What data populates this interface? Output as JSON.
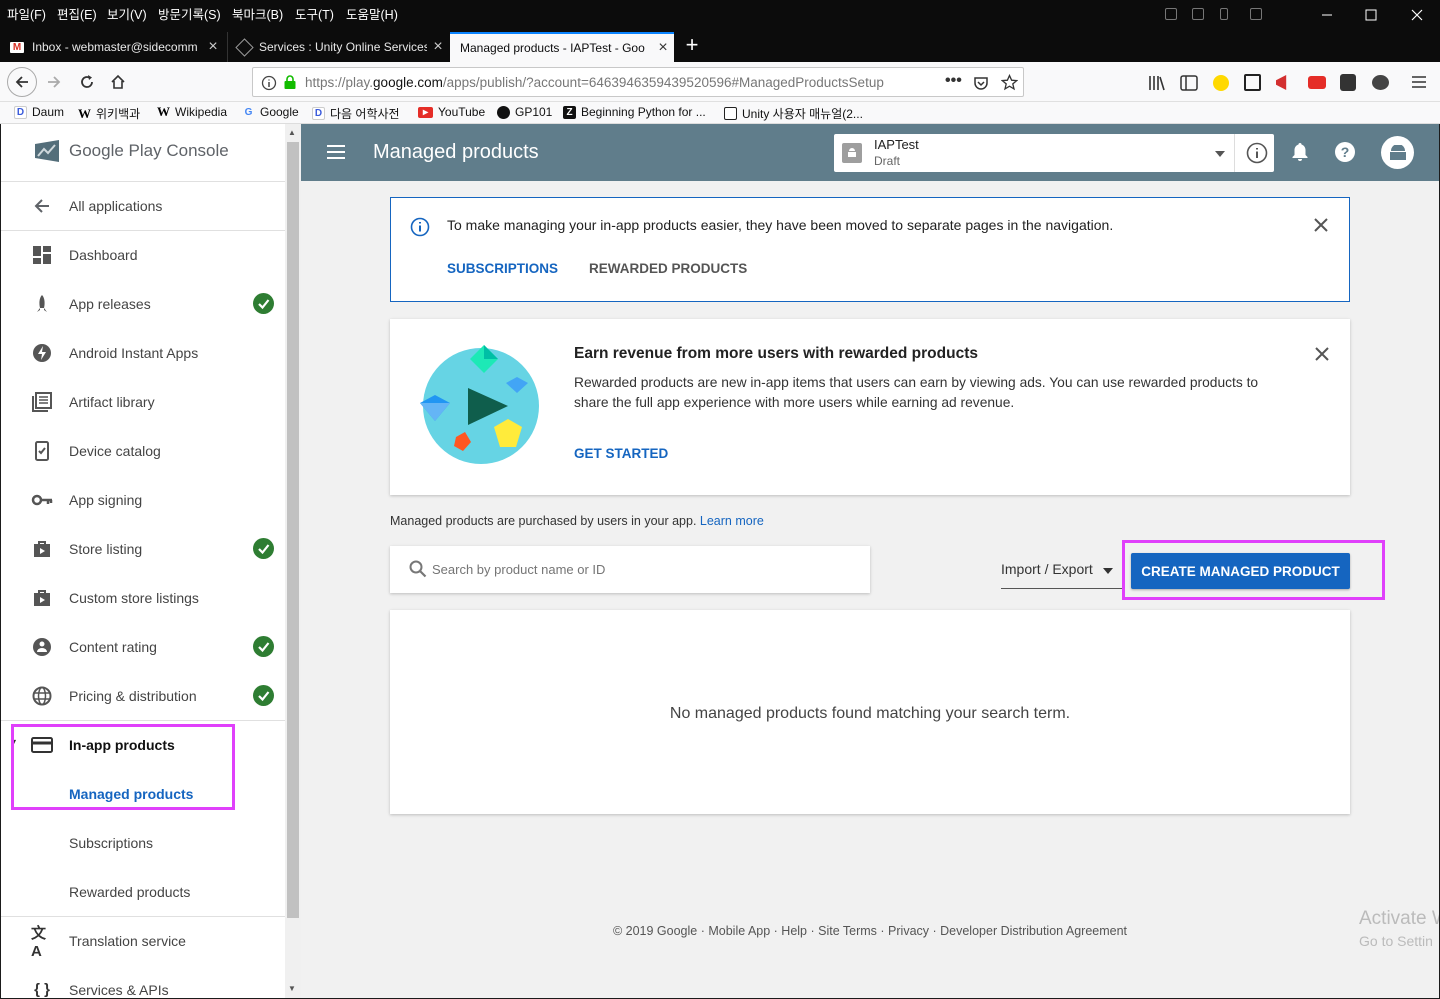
{
  "menubar": {
    "items": [
      "파일(F)",
      "편집(E)",
      "보기(V)",
      "방문기록(S)",
      "북마크(B)",
      "도구(T)",
      "도움말(H)"
    ]
  },
  "tabs": [
    {
      "title": "Inbox - webmaster@sidecomm",
      "icon": "gmail-icon"
    },
    {
      "title": "Services : Unity Online Services",
      "icon": "unity-icon"
    },
    {
      "title": "Managed products - IAPTest - Goo",
      "icon": "none"
    }
  ],
  "url": "https://play.google.com/apps/publish/?account=6463946359439520596#ManagedProductsSetup",
  "url_domain": "google.com",
  "bookmarks": [
    "Daum",
    "위키백과",
    "Wikipedia",
    "Google",
    "다음 어학사전",
    "YouTube",
    "GP101",
    "Beginning Python for ...",
    "Unity 사용자 매뉴얼(2..."
  ],
  "sidebar": {
    "logo": "Google Play Console",
    "back": "All applications",
    "items": [
      {
        "label": "Dashboard",
        "icon": "dashboard-icon",
        "check": false
      },
      {
        "label": "App releases",
        "icon": "rocket-icon",
        "check": true
      },
      {
        "label": "Android Instant Apps",
        "icon": "bolt-icon",
        "check": false
      },
      {
        "label": "Artifact library",
        "icon": "library-icon",
        "check": false
      },
      {
        "label": "Device catalog",
        "icon": "device-icon",
        "check": false
      },
      {
        "label": "App signing",
        "icon": "key-icon",
        "check": false
      },
      {
        "label": "Store listing",
        "icon": "store-icon",
        "check": true
      },
      {
        "label": "Custom store listings",
        "icon": "store-icon",
        "check": false
      },
      {
        "label": "Content rating",
        "icon": "rating-icon",
        "check": true
      },
      {
        "label": "Pricing & distribution",
        "icon": "globe-icon",
        "check": true
      }
    ],
    "inapp": "In-app products",
    "sub": [
      "Managed products",
      "Subscriptions",
      "Rewarded products"
    ],
    "after": [
      "Translation service",
      "Services & APIs"
    ]
  },
  "topbar": {
    "title": "Managed products",
    "app_name": "IAPTest",
    "app_status": "Draft"
  },
  "notice": {
    "text": "To make managing your in-app products easier, they have been moved to separate pages in the navigation.",
    "link1": "SUBSCRIPTIONS",
    "link2": "REWARDED PRODUCTS"
  },
  "promo": {
    "title": "Earn revenue from more users with rewarded products",
    "body": "Rewarded products are new in-app items that users can earn by viewing ads. You can use rewarded products to share the full app experience with more users while earning ad revenue.",
    "cta": "GET STARTED"
  },
  "info": {
    "text": "Managed products are purchased by users in your app. ",
    "link": "Learn more"
  },
  "search": {
    "placeholder": "Search by product name or ID"
  },
  "import_export": "Import / Export",
  "create_button": "CREATE MANAGED PRODUCT",
  "empty": "No managed products found matching your search term.",
  "footer": "© 2019 Google · Mobile App · Help · Site Terms · Privacy · Developer Distribution Agreement",
  "watermark": {
    "line1": "Activate W",
    "line2": "Go to Settin"
  },
  "colors": {
    "topbar": "#607d8b",
    "primary_button": "#1565c0",
    "check": "#2e7d32",
    "highlight": "#e040fb"
  }
}
